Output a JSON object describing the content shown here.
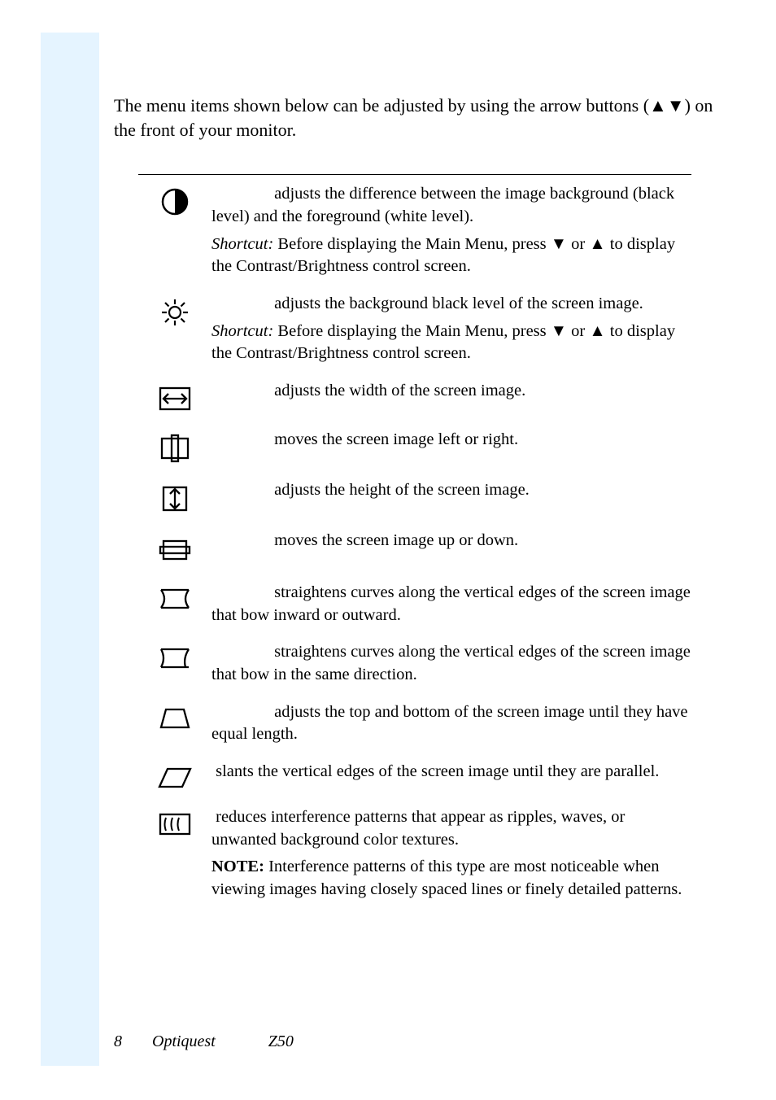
{
  "intro": "The menu items shown below can be adjusted by using the arrow buttons (▲▼) on the front of your monitor.",
  "items": [
    {
      "icon": "contrast",
      "body": "<span class=\"label-indent\"></span> adjusts the difference between the image background (black level) and the foreground (white level).",
      "extra": "<em>Shortcut:</em> Before displaying the Main Menu, press ▼ or ▲ to display the Contrast/Brightness control screen."
    },
    {
      "icon": "brightness",
      "body": "<span class=\"label-indent\"></span> adjusts the background black level of the screen image.",
      "extra": "<em>Shortcut:</em> Before displaying the Main Menu, press ▼ or ▲ to display the Contrast/Brightness control screen."
    },
    {
      "icon": "hsize",
      "body": "<span class=\"label-indent\"></span> adjusts the width of the screen image."
    },
    {
      "icon": "hpos",
      "body": "<span class=\"label-indent\"></span> moves the screen image left or right."
    },
    {
      "icon": "vsize",
      "body": "<span class=\"label-indent\"></span> adjusts the height of the screen image."
    },
    {
      "icon": "vpos",
      "body": "<span class=\"label-indent\"></span> moves the screen image up or down."
    },
    {
      "icon": "pincushion",
      "body": "<span class=\"label-indent\"></span> straightens curves along the vertical edges of the screen image that bow inward or outward."
    },
    {
      "icon": "pinbalance",
      "body": "<span class=\"label-indent\"></span> straightens curves along the vertical edges of the screen image that bow in the same direction."
    },
    {
      "icon": "trapezoid",
      "body": "<span class=\"label-indent\"></span> adjusts the top and bottom of the screen image until they have equal length."
    },
    {
      "icon": "parallelogram",
      "body": "<span class=\"label-indent2\"></span> slants the vertical edges of the screen image until they are parallel."
    },
    {
      "icon": "moire",
      "body": "<span class=\"label-indent2\"></span> reduces interference patterns that appear as ripples, waves, or unwanted background color textures.",
      "extra": "<b>NOTE:</b> Interference patterns of this type are most noticeable when viewing images having closely spaced lines or finely detailed patterns."
    }
  ],
  "footer": {
    "page": "8",
    "brand": "Optiquest",
    "model": "Z50"
  },
  "icons": {
    "contrast": "<svg width=\"38\" height=\"38\" viewBox=\"0 0 38 38\"><circle cx=\"19\" cy=\"19\" r=\"15\" fill=\"none\" stroke=\"#000\" stroke-width=\"2.5\"/><path d=\"M19 4 A15 15 0 0 1 19 34 Z\" fill=\"#000\"/></svg>",
    "brightness": "<svg width=\"40\" height=\"40\" viewBox=\"0 0 40 40\"><circle cx=\"20\" cy=\"20\" r=\"7\" fill=\"none\" stroke=\"#000\" stroke-width=\"2.2\"/><g stroke=\"#000\" stroke-width=\"2.2\"><line x1=\"20\" y1=\"4\" x2=\"20\" y2=\"10\"/><line x1=\"20\" y1=\"30\" x2=\"20\" y2=\"36\"/><line x1=\"4\" y1=\"20\" x2=\"10\" y2=\"20\"/><line x1=\"30\" y1=\"20\" x2=\"36\" y2=\"20\"/><line x1=\"8\" y1=\"8\" x2=\"12.5\" y2=\"12.5\"/><line x1=\"27.5\" y1=\"27.5\" x2=\"32\" y2=\"32\"/><line x1=\"8\" y1=\"32\" x2=\"12.5\" y2=\"27.5\"/><line x1=\"27.5\" y1=\"12.5\" x2=\"32\" y2=\"8\"/></g></svg>",
    "hsize": "<svg width=\"44\" height=\"38\" viewBox=\"0 0 44 38\"><rect x=\"4\" y=\"6\" width=\"36\" height=\"26\" fill=\"none\" stroke=\"#000\" stroke-width=\"2.3\"/><line x1=\"10\" y1=\"19\" x2=\"34\" y2=\"19\" stroke=\"#000\" stroke-width=\"2.3\"/><polyline points=\"14,13 8,19 14,25\" fill=\"none\" stroke=\"#000\" stroke-width=\"2.3\"/><polyline points=\"30,13 36,19 30,25\" fill=\"none\" stroke=\"#000\" stroke-width=\"2.3\"/></svg>",
    "hpos": "<svg width=\"46\" height=\"40\" viewBox=\"0 0 46 40\"><rect x=\"7\" y=\"8\" width=\"32\" height=\"24\" fill=\"none\" stroke=\"#000\" stroke-width=\"2.3\"/><rect x=\"19\" y=\"4\" width=\"8\" height=\"32\" fill=\"none\" stroke=\"#000\" stroke-width=\"2.3\"/></svg>",
    "vsize": "<svg width=\"40\" height=\"40\" viewBox=\"0 0 40 40\"><rect x=\"6\" y=\"6\" width=\"28\" height=\"28\" fill=\"none\" stroke=\"#000\" stroke-width=\"2.3\"/><line x1=\"20\" y1=\"10\" x2=\"20\" y2=\"30\" stroke=\"#000\" stroke-width=\"2.3\"/><polyline points=\"14,14 20,8 26,14\" fill=\"none\" stroke=\"#000\" stroke-width=\"2.3\"/><polyline points=\"14,26 20,32 26,26\" fill=\"none\" stroke=\"#000\" stroke-width=\"2.3\"/></svg>",
    "vpos": "<svg width=\"44\" height=\"42\" viewBox=\"0 0 44 42\"><rect x=\"8\" y=\"10\" width=\"28\" height=\"22\" fill=\"none\" stroke=\"#000\" stroke-width=\"2.3\"/><rect x=\"4\" y=\"17\" width=\"36\" height=\"8\" fill=\"none\" stroke=\"#000\" stroke-width=\"2.3\"/></svg>",
    "pincushion": "<svg width=\"46\" height=\"34\" viewBox=\"0 0 46 34\"><line x1=\"6\" y1=\"6\" x2=\"40\" y2=\"6\" stroke=\"#000\" stroke-width=\"2.3\"/><line x1=\"6\" y1=\"28\" x2=\"40\" y2=\"28\" stroke=\"#000\" stroke-width=\"2.3\"/><path d=\"M6 6 Q 14 17 6 28\" fill=\"none\" stroke=\"#000\" stroke-width=\"2.3\"/><path d=\"M40 6 Q 32 17 40 28\" fill=\"none\" stroke=\"#000\" stroke-width=\"2.3\"/></svg>",
    "pinbalance": "<svg width=\"46\" height=\"34\" viewBox=\"0 0 46 34\"><line x1=\"6\" y1=\"6\" x2=\"40\" y2=\"6\" stroke=\"#000\" stroke-width=\"2.3\"/><line x1=\"6\" y1=\"28\" x2=\"40\" y2=\"28\" stroke=\"#000\" stroke-width=\"2.3\"/><path d=\"M6 6 Q 12 17 6 28\" fill=\"none\" stroke=\"#000\" stroke-width=\"2.3\"/><path d=\"M40 6 Q 33 17 36 28\" fill=\"none\" stroke=\"#000\" stroke-width=\"2.3\"/></svg>",
    "trapezoid": "<svg width=\"46\" height=\"34\" viewBox=\"0 0 46 34\"><polygon points=\"12,6 34,6 40,28 6,28\" fill=\"none\" stroke=\"#000\" stroke-width=\"2.3\"/></svg>",
    "parallelogram": "<svg width=\"46\" height=\"34\" viewBox=\"0 0 46 34\"><polygon points=\"14,6 42,6 32,28 4,28\" fill=\"none\" stroke=\"#000\" stroke-width=\"2.3\"/></svg>",
    "moire": "<svg width=\"46\" height=\"36\" viewBox=\"0 0 46 36\"><rect x=\"5\" y=\"6\" width=\"36\" height=\"24\" fill=\"none\" stroke=\"#000\" stroke-width=\"2.3\"/><path d=\"M12 10 Q 9 18 12 26\" fill=\"none\" stroke=\"#000\" stroke-width=\"2\"/><path d=\"M20 10 Q 17 18 20 26\" fill=\"none\" stroke=\"#000\" stroke-width=\"2\"/><path d=\"M28 10 Q 25 18 28 26\" fill=\"none\" stroke=\"#000\" stroke-width=\"2\"/></svg>"
  }
}
